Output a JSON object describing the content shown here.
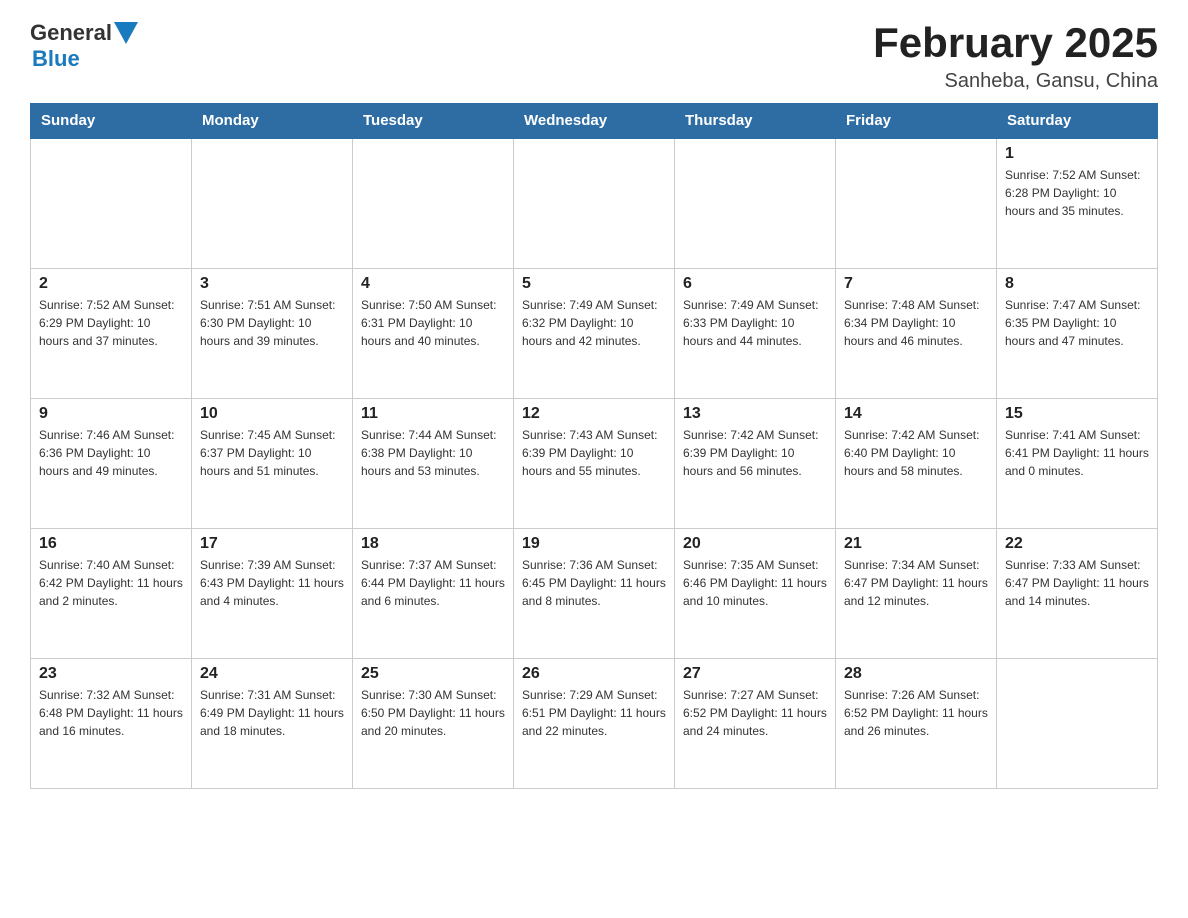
{
  "header": {
    "logo_general": "General",
    "logo_blue": "Blue",
    "month_title": "February 2025",
    "location": "Sanheba, Gansu, China"
  },
  "days_of_week": [
    "Sunday",
    "Monday",
    "Tuesday",
    "Wednesday",
    "Thursday",
    "Friday",
    "Saturday"
  ],
  "weeks": [
    [
      {
        "day": "",
        "info": ""
      },
      {
        "day": "",
        "info": ""
      },
      {
        "day": "",
        "info": ""
      },
      {
        "day": "",
        "info": ""
      },
      {
        "day": "",
        "info": ""
      },
      {
        "day": "",
        "info": ""
      },
      {
        "day": "1",
        "info": "Sunrise: 7:52 AM\nSunset: 6:28 PM\nDaylight: 10 hours\nand 35 minutes."
      }
    ],
    [
      {
        "day": "2",
        "info": "Sunrise: 7:52 AM\nSunset: 6:29 PM\nDaylight: 10 hours\nand 37 minutes."
      },
      {
        "day": "3",
        "info": "Sunrise: 7:51 AM\nSunset: 6:30 PM\nDaylight: 10 hours\nand 39 minutes."
      },
      {
        "day": "4",
        "info": "Sunrise: 7:50 AM\nSunset: 6:31 PM\nDaylight: 10 hours\nand 40 minutes."
      },
      {
        "day": "5",
        "info": "Sunrise: 7:49 AM\nSunset: 6:32 PM\nDaylight: 10 hours\nand 42 minutes."
      },
      {
        "day": "6",
        "info": "Sunrise: 7:49 AM\nSunset: 6:33 PM\nDaylight: 10 hours\nand 44 minutes."
      },
      {
        "day": "7",
        "info": "Sunrise: 7:48 AM\nSunset: 6:34 PM\nDaylight: 10 hours\nand 46 minutes."
      },
      {
        "day": "8",
        "info": "Sunrise: 7:47 AM\nSunset: 6:35 PM\nDaylight: 10 hours\nand 47 minutes."
      }
    ],
    [
      {
        "day": "9",
        "info": "Sunrise: 7:46 AM\nSunset: 6:36 PM\nDaylight: 10 hours\nand 49 minutes."
      },
      {
        "day": "10",
        "info": "Sunrise: 7:45 AM\nSunset: 6:37 PM\nDaylight: 10 hours\nand 51 minutes."
      },
      {
        "day": "11",
        "info": "Sunrise: 7:44 AM\nSunset: 6:38 PM\nDaylight: 10 hours\nand 53 minutes."
      },
      {
        "day": "12",
        "info": "Sunrise: 7:43 AM\nSunset: 6:39 PM\nDaylight: 10 hours\nand 55 minutes."
      },
      {
        "day": "13",
        "info": "Sunrise: 7:42 AM\nSunset: 6:39 PM\nDaylight: 10 hours\nand 56 minutes."
      },
      {
        "day": "14",
        "info": "Sunrise: 7:42 AM\nSunset: 6:40 PM\nDaylight: 10 hours\nand 58 minutes."
      },
      {
        "day": "15",
        "info": "Sunrise: 7:41 AM\nSunset: 6:41 PM\nDaylight: 11 hours\nand 0 minutes."
      }
    ],
    [
      {
        "day": "16",
        "info": "Sunrise: 7:40 AM\nSunset: 6:42 PM\nDaylight: 11 hours\nand 2 minutes."
      },
      {
        "day": "17",
        "info": "Sunrise: 7:39 AM\nSunset: 6:43 PM\nDaylight: 11 hours\nand 4 minutes."
      },
      {
        "day": "18",
        "info": "Sunrise: 7:37 AM\nSunset: 6:44 PM\nDaylight: 11 hours\nand 6 minutes."
      },
      {
        "day": "19",
        "info": "Sunrise: 7:36 AM\nSunset: 6:45 PM\nDaylight: 11 hours\nand 8 minutes."
      },
      {
        "day": "20",
        "info": "Sunrise: 7:35 AM\nSunset: 6:46 PM\nDaylight: 11 hours\nand 10 minutes."
      },
      {
        "day": "21",
        "info": "Sunrise: 7:34 AM\nSunset: 6:47 PM\nDaylight: 11 hours\nand 12 minutes."
      },
      {
        "day": "22",
        "info": "Sunrise: 7:33 AM\nSunset: 6:47 PM\nDaylight: 11 hours\nand 14 minutes."
      }
    ],
    [
      {
        "day": "23",
        "info": "Sunrise: 7:32 AM\nSunset: 6:48 PM\nDaylight: 11 hours\nand 16 minutes."
      },
      {
        "day": "24",
        "info": "Sunrise: 7:31 AM\nSunset: 6:49 PM\nDaylight: 11 hours\nand 18 minutes."
      },
      {
        "day": "25",
        "info": "Sunrise: 7:30 AM\nSunset: 6:50 PM\nDaylight: 11 hours\nand 20 minutes."
      },
      {
        "day": "26",
        "info": "Sunrise: 7:29 AM\nSunset: 6:51 PM\nDaylight: 11 hours\nand 22 minutes."
      },
      {
        "day": "27",
        "info": "Sunrise: 7:27 AM\nSunset: 6:52 PM\nDaylight: 11 hours\nand 24 minutes."
      },
      {
        "day": "28",
        "info": "Sunrise: 7:26 AM\nSunset: 6:52 PM\nDaylight: 11 hours\nand 26 minutes."
      },
      {
        "day": "",
        "info": ""
      }
    ]
  ]
}
